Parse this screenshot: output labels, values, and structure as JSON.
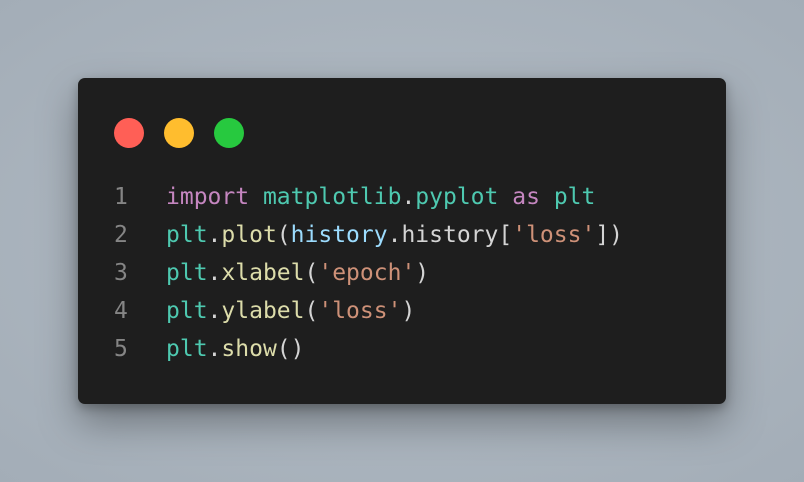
{
  "window": {
    "controls": [
      "close",
      "minimize",
      "maximize"
    ],
    "colors": {
      "close": "#ff5f56",
      "minimize": "#ffbd2e",
      "maximize": "#27c93f"
    }
  },
  "code": {
    "lines": [
      {
        "number": "1",
        "tokens": [
          {
            "text": "import",
            "kind": "keyword"
          },
          {
            "text": " ",
            "kind": "plain"
          },
          {
            "text": "matplotlib",
            "kind": "module"
          },
          {
            "text": ".",
            "kind": "plain"
          },
          {
            "text": "pyplot",
            "kind": "module"
          },
          {
            "text": " ",
            "kind": "plain"
          },
          {
            "text": "as",
            "kind": "keyword"
          },
          {
            "text": " ",
            "kind": "plain"
          },
          {
            "text": "plt",
            "kind": "module"
          }
        ]
      },
      {
        "number": "2",
        "tokens": [
          {
            "text": "plt",
            "kind": "module"
          },
          {
            "text": ".",
            "kind": "plain"
          },
          {
            "text": "plot",
            "kind": "function"
          },
          {
            "text": "(",
            "kind": "plain"
          },
          {
            "text": "history",
            "kind": "variable"
          },
          {
            "text": ".history[",
            "kind": "plain"
          },
          {
            "text": "'loss'",
            "kind": "string"
          },
          {
            "text": "])",
            "kind": "plain"
          }
        ]
      },
      {
        "number": "3",
        "tokens": [
          {
            "text": "plt",
            "kind": "module"
          },
          {
            "text": ".",
            "kind": "plain"
          },
          {
            "text": "xlabel",
            "kind": "function"
          },
          {
            "text": "(",
            "kind": "plain"
          },
          {
            "text": "'epoch'",
            "kind": "string"
          },
          {
            "text": ")",
            "kind": "plain"
          }
        ]
      },
      {
        "number": "4",
        "tokens": [
          {
            "text": "plt",
            "kind": "module"
          },
          {
            "text": ".",
            "kind": "plain"
          },
          {
            "text": "ylabel",
            "kind": "function"
          },
          {
            "text": "(",
            "kind": "plain"
          },
          {
            "text": "'loss'",
            "kind": "string"
          },
          {
            "text": ")",
            "kind": "plain"
          }
        ]
      },
      {
        "number": "5",
        "tokens": [
          {
            "text": "plt",
            "kind": "module"
          },
          {
            "text": ".",
            "kind": "plain"
          },
          {
            "text": "show",
            "kind": "function"
          },
          {
            "text": "()",
            "kind": "plain"
          }
        ]
      }
    ]
  }
}
